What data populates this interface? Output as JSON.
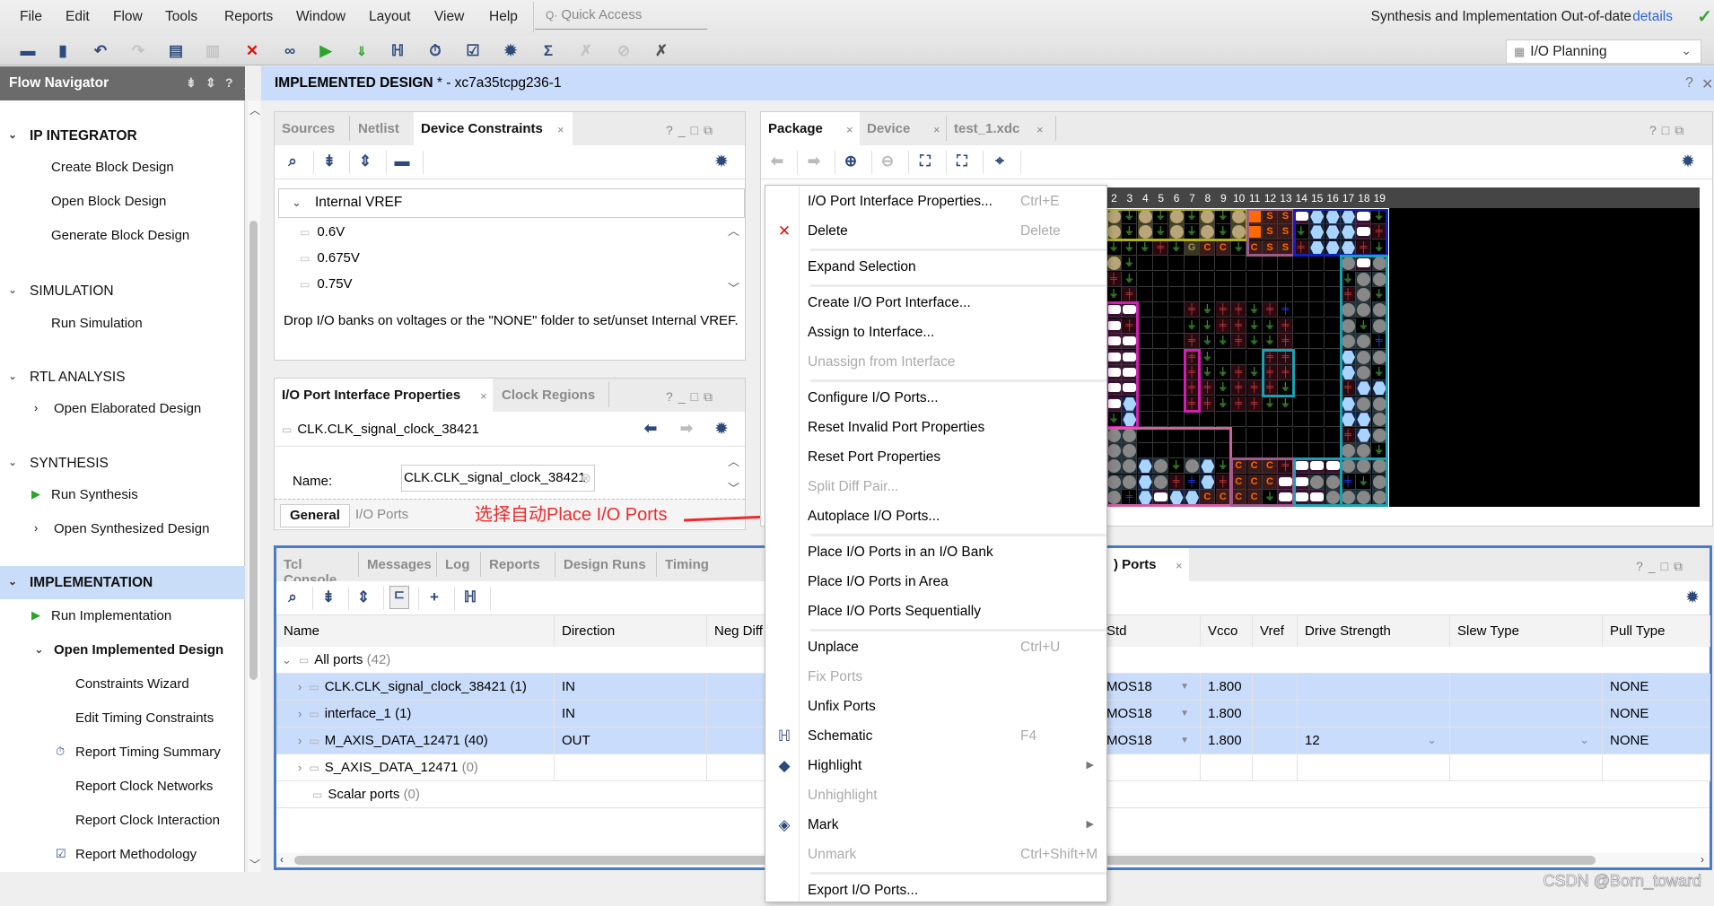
{
  "menubar": {
    "items": [
      "File",
      "Edit",
      "Flow",
      "Tools",
      "Reports",
      "Window",
      "Layout",
      "View",
      "Help"
    ],
    "quick_access_placeholder": "Quick Access",
    "status_text": "Synthesis and Implementation Out-of-date",
    "details_link": "details"
  },
  "toolbar": {
    "icons": [
      "open-project",
      "save",
      "undo",
      "redo",
      "copy",
      "paste",
      "delete",
      "find",
      "run",
      "program-device",
      "schematic",
      "report-timing",
      "report-methodology",
      "settings",
      "sum",
      "disabled-a",
      "disabled-b",
      "disabled-c"
    ],
    "layout_select": "I/O Planning"
  },
  "flow_navigator": {
    "title": "Flow Navigator",
    "sections": [
      {
        "label": "IP INTEGRATOR",
        "items": [
          "Create Block Design",
          "Open Block Design",
          "Generate Block Design"
        ]
      },
      {
        "label": "SIMULATION",
        "items": [
          "Run Simulation"
        ]
      },
      {
        "label": "RTL ANALYSIS",
        "items": [
          "Open Elaborated Design"
        ]
      },
      {
        "label": "SYNTHESIS",
        "items": [
          "Run Synthesis",
          "Open Synthesized Design"
        ]
      },
      {
        "label": "IMPLEMENTATION",
        "items": [
          "Run Implementation",
          "Open Implemented Design",
          "Constraints Wizard",
          "Edit Timing Constraints",
          "Report Timing Summary",
          "Report Clock Networks",
          "Report Clock Interaction",
          "Report Methodology"
        ]
      }
    ]
  },
  "design_header": {
    "title": "IMPLEMENTED DESIGN",
    "suffix": " * - xc7a35tcpg236-1"
  },
  "device_constraints_panel": {
    "tabs": [
      "Sources",
      "Netlist",
      "Device Constraints"
    ],
    "active_tab": "Device Constraints",
    "tree_root": "Internal VREF",
    "items": [
      "0.6V",
      "0.675V",
      "0.75V"
    ],
    "note": "Drop I/O banks on voltages or the \"NONE\" folder to set/unset Internal VREF."
  },
  "io_props_panel": {
    "tabs": [
      "I/O Port Interface Properties",
      "Clock Regions"
    ],
    "selected_object": "CLK.CLK_signal_clock_38421",
    "name_label": "Name:",
    "name_value": "CLK.CLK_signal_clock_38421",
    "subtabs": [
      "General",
      "I/O Ports"
    ]
  },
  "annotation": "选择自动Place I/O Ports",
  "bottom_panel": {
    "tabs": [
      "Tcl Console",
      "Messages",
      "Log",
      "Reports",
      "Design Runs",
      "Timing"
    ],
    "right_tab": ") Ports",
    "columns": [
      "Name",
      "Direction",
      "Neg Diff",
      "Std",
      "Vcco",
      "Vref",
      "Drive Strength",
      "Slew Type",
      "Pull Type"
    ],
    "root": {
      "label": "All ports",
      "count": "(42)"
    },
    "rows": [
      {
        "name": "CLK.CLK_signal_clock_38421",
        "count": "(1)",
        "direction": "IN",
        "std": "MOS18",
        "vcco": "1.800",
        "drive": "",
        "slew": "",
        "pull": "NONE",
        "selected": true
      },
      {
        "name": "interface_1",
        "count": "(1)",
        "direction": "IN",
        "std": "MOS18",
        "vcco": "1.800",
        "drive": "",
        "slew": "",
        "pull": "NONE",
        "selected": true
      },
      {
        "name": "M_AXIS_DATA_12471",
        "count": "(40)",
        "direction": "OUT",
        "std": "MOS18",
        "vcco": "1.800",
        "drive": "12",
        "slew": "",
        "pull": "NONE",
        "selected": true
      },
      {
        "name": "S_AXIS_DATA_12471",
        "count": "(0)",
        "direction": "",
        "std": "",
        "vcco": "",
        "drive": "",
        "slew": "",
        "pull": "",
        "selected": false
      }
    ],
    "scalar": {
      "label": "Scalar ports",
      "count": "(0)"
    }
  },
  "package_panel": {
    "tabs": [
      "Package",
      "Device",
      "test_1.xdc"
    ],
    "active_tab": "Package",
    "column_numbers": [
      "2",
      "3",
      "4",
      "5",
      "6",
      "7",
      "8",
      "9",
      "10",
      "11",
      "12",
      "13",
      "14",
      "15",
      "16",
      "17",
      "18",
      "19"
    ],
    "grid_legend": {
      "t": "tan pin",
      "g": "ground",
      "r": "power",
      "o": "orange config",
      "S": "S config",
      "C": "C clock",
      "G": "G",
      "w": "white diff",
      "l": "light-blue io",
      "e": "grey io",
      "b": "blue power",
      ".": "empty"
    },
    "grid": [
      "tgtgtgtgtoSSwlllwg",
      "tgtgtgtgtoSSglllwr",
      "gggrgGCCgCSSrlllrg",
      "tg.............ewe",
      "rg.............gee",
      "gr.............reg",
      "ww...rgrrgrb...eee",
      "wr...ggrrggr...ege",
      "ww...rggrggr...eeb",
      "ww...rg...rr...lee",
      "ww...rggrgrr...leg",
      "ww...rrgrrrg...rll",
      "wl...rrgrrgg...lee",
      "gl.............lle",
      "ee.............rle",
      "ee.............eeg",
      "eelegelgCCCrwwweee",
      "eelerblrCCCwweebge",
      "eblwllCCCCgwwweeee"
    ]
  },
  "context_menu": {
    "items": [
      {
        "label": "I/O Port Interface Properties...",
        "shortcut": "Ctrl+E",
        "enabled": true
      },
      {
        "label": "Delete",
        "shortcut": "Delete",
        "enabled": true,
        "icon": "delete"
      },
      {
        "sep": true
      },
      {
        "label": "Expand Selection",
        "enabled": true
      },
      {
        "sep": true
      },
      {
        "label": "Create I/O Port Interface...",
        "enabled": true
      },
      {
        "label": "Assign to Interface...",
        "enabled": true
      },
      {
        "label": "Unassign from Interface",
        "enabled": false
      },
      {
        "sep": true
      },
      {
        "label": "Configure I/O Ports...",
        "enabled": true
      },
      {
        "label": "Reset Invalid Port Properties",
        "enabled": true
      },
      {
        "label": "Reset Port Properties",
        "enabled": true
      },
      {
        "label": "Split Diff Pair...",
        "enabled": false
      },
      {
        "label": "Autoplace I/O Ports...",
        "enabled": true
      },
      {
        "sep": true
      },
      {
        "label": "Place I/O Ports in an I/O Bank",
        "enabled": true
      },
      {
        "label": "Place I/O Ports in Area",
        "enabled": true
      },
      {
        "label": "Place I/O Ports Sequentially",
        "enabled": true
      },
      {
        "sep": true
      },
      {
        "label": "Unplace",
        "shortcut": "Ctrl+U",
        "enabled": true
      },
      {
        "label": "Fix Ports",
        "enabled": false
      },
      {
        "label": "Unfix Ports",
        "enabled": true
      },
      {
        "label": "Schematic",
        "shortcut": "F4",
        "enabled": true,
        "icon": "schematic"
      },
      {
        "label": "Highlight",
        "enabled": true,
        "submenu": true,
        "icon": "highlight"
      },
      {
        "label": "Unhighlight",
        "enabled": false
      },
      {
        "label": "Mark",
        "enabled": true,
        "submenu": true,
        "icon": "mark"
      },
      {
        "label": "Unmark",
        "shortcut": "Ctrl+Shift+M",
        "enabled": false
      },
      {
        "sep": true
      },
      {
        "label": "Export I/O Ports...",
        "enabled": true
      }
    ]
  },
  "watermark": "CSDN @Born_toward",
  "colors": {
    "accent": "#cadcfb",
    "panel_border_active": "#4a7bc8",
    "annotation": "#ee2a2a"
  }
}
